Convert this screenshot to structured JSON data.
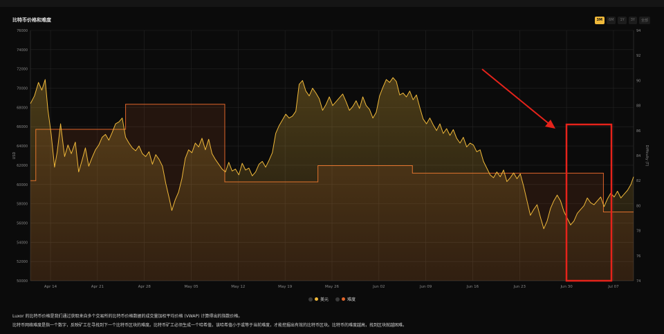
{
  "title": "比特币价格和难度",
  "ranges": [
    "3M",
    "6M",
    "1Y",
    "3Y",
    "全部"
  ],
  "active_range": "3M",
  "descriptions": [
    "Luxor 的比特币价格是我们通过获取来自多个交易所的比特币价格数据的成交量加权平均价格 (VWAP) 计算得出的指数价格。",
    "比特币网络难度是指一个数字，反映矿工在寻找到下一个比特币区块的难度。比特币矿工必须生成一个哈希值，该哈希值小于或等于当前难度，才能挖掘出有效的比特币区块。比特币的难度越高，找到区块就越困难。"
  ],
  "colors": {
    "price": "#f0b93a",
    "difficulty": "#e0652b",
    "annotation": "#e5231b"
  },
  "chart_data": {
    "type": "line",
    "xlabel": "",
    "ylabel": "USD",
    "y2label": "Difficulty (T)",
    "ylim": [
      50000,
      76000
    ],
    "y2lim": [
      74,
      94
    ],
    "y_ticks": [
      50000,
      52000,
      54000,
      56000,
      58000,
      60000,
      62000,
      64000,
      66000,
      68000,
      70000,
      72000,
      74000,
      76000
    ],
    "y2_ticks": [
      74,
      76,
      78,
      80,
      82,
      84,
      86,
      88,
      90,
      92,
      94
    ],
    "x_ticks": [
      "Apr 14",
      "Apr 21",
      "Apr 28",
      "May 05",
      "May 12",
      "May 19",
      "May 26",
      "Jun 02",
      "Jun 09",
      "Jun 16",
      "Jun 23",
      "Jun 30",
      "Jul 07"
    ],
    "x_tick_days": [
      3,
      10,
      17,
      24,
      31,
      38,
      45,
      52,
      59,
      66,
      73,
      80,
      87
    ],
    "x_range_days": [
      0,
      90
    ],
    "series": [
      {
        "name": "美元",
        "kind": "price",
        "points": [
          [
            0,
            68400
          ],
          [
            0.6,
            69200
          ],
          [
            1.2,
            70600
          ],
          [
            1.7,
            69800
          ],
          [
            2.2,
            70900
          ],
          [
            2.6,
            67800
          ],
          [
            3.1,
            65200
          ],
          [
            3.6,
            61800
          ],
          [
            4.0,
            63400
          ],
          [
            4.5,
            66300
          ],
          [
            5.1,
            62900
          ],
          [
            5.6,
            64100
          ],
          [
            6.1,
            63200
          ],
          [
            6.7,
            64400
          ],
          [
            7.2,
            61300
          ],
          [
            7.7,
            62500
          ],
          [
            8.2,
            63800
          ],
          [
            8.7,
            61900
          ],
          [
            9.2,
            62800
          ],
          [
            9.7,
            63600
          ],
          [
            10.2,
            64100
          ],
          [
            10.7,
            64900
          ],
          [
            11.2,
            65200
          ],
          [
            11.7,
            64600
          ],
          [
            12.2,
            65400
          ],
          [
            12.7,
            66300
          ],
          [
            13.2,
            66500
          ],
          [
            13.7,
            66900
          ],
          [
            14.2,
            64900
          ],
          [
            14.7,
            64300
          ],
          [
            15.2,
            63800
          ],
          [
            15.7,
            63500
          ],
          [
            16.2,
            64000
          ],
          [
            16.7,
            63200
          ],
          [
            17.2,
            62900
          ],
          [
            17.7,
            63400
          ],
          [
            18.2,
            62100
          ],
          [
            18.7,
            63100
          ],
          [
            19.2,
            62600
          ],
          [
            19.7,
            61900
          ],
          [
            20.2,
            60100
          ],
          [
            20.7,
            58600
          ],
          [
            21.1,
            57300
          ],
          [
            21.6,
            58400
          ],
          [
            22.1,
            59200
          ],
          [
            22.6,
            60600
          ],
          [
            23.1,
            62700
          ],
          [
            23.6,
            63600
          ],
          [
            24.1,
            63300
          ],
          [
            24.6,
            64300
          ],
          [
            25.1,
            63900
          ],
          [
            25.6,
            64800
          ],
          [
            26.1,
            63600
          ],
          [
            26.6,
            64700
          ],
          [
            27.1,
            63200
          ],
          [
            27.6,
            62600
          ],
          [
            28.1,
            62100
          ],
          [
            28.6,
            61600
          ],
          [
            29.1,
            61300
          ],
          [
            29.6,
            62300
          ],
          [
            30.1,
            61400
          ],
          [
            30.6,
            61600
          ],
          [
            31.1,
            61000
          ],
          [
            31.6,
            62200
          ],
          [
            32.1,
            61500
          ],
          [
            32.6,
            61700
          ],
          [
            33.1,
            60900
          ],
          [
            33.6,
            61300
          ],
          [
            34.1,
            62100
          ],
          [
            34.6,
            62400
          ],
          [
            35.1,
            61800
          ],
          [
            35.6,
            62500
          ],
          [
            36.1,
            63300
          ],
          [
            36.6,
            65300
          ],
          [
            37.1,
            66100
          ],
          [
            37.6,
            66700
          ],
          [
            38.1,
            67300
          ],
          [
            38.6,
            66900
          ],
          [
            39.1,
            67100
          ],
          [
            39.6,
            67600
          ],
          [
            40.1,
            70400
          ],
          [
            40.6,
            70800
          ],
          [
            41.1,
            69700
          ],
          [
            41.6,
            69200
          ],
          [
            42.1,
            70000
          ],
          [
            42.6,
            69500
          ],
          [
            43.1,
            68900
          ],
          [
            43.6,
            67700
          ],
          [
            44.1,
            68300
          ],
          [
            44.6,
            69100
          ],
          [
            45.1,
            68200
          ],
          [
            45.6,
            68600
          ],
          [
            46.1,
            69000
          ],
          [
            46.6,
            69400
          ],
          [
            47.1,
            68600
          ],
          [
            47.6,
            67700
          ],
          [
            48.1,
            68100
          ],
          [
            48.6,
            68700
          ],
          [
            49.1,
            67900
          ],
          [
            49.6,
            69100
          ],
          [
            50.1,
            68200
          ],
          [
            50.6,
            67800
          ],
          [
            51.1,
            66900
          ],
          [
            51.6,
            67500
          ],
          [
            52.1,
            69200
          ],
          [
            52.6,
            70100
          ],
          [
            53.1,
            70900
          ],
          [
            53.6,
            70600
          ],
          [
            54.1,
            71100
          ],
          [
            54.6,
            70700
          ],
          [
            55.1,
            69300
          ],
          [
            55.6,
            69500
          ],
          [
            56.1,
            69100
          ],
          [
            56.6,
            69700
          ],
          [
            57.1,
            68800
          ],
          [
            57.6,
            69300
          ],
          [
            58.1,
            68000
          ],
          [
            58.6,
            66800
          ],
          [
            59.1,
            66300
          ],
          [
            59.6,
            66900
          ],
          [
            60.1,
            66200
          ],
          [
            60.6,
            65600
          ],
          [
            61.1,
            66300
          ],
          [
            61.6,
            65300
          ],
          [
            62.1,
            65800
          ],
          [
            62.6,
            65100
          ],
          [
            63.1,
            65700
          ],
          [
            63.6,
            64800
          ],
          [
            64.1,
            64300
          ],
          [
            64.6,
            64900
          ],
          [
            65.1,
            63900
          ],
          [
            65.6,
            64300
          ],
          [
            66.1,
            64100
          ],
          [
            66.6,
            63400
          ],
          [
            67.1,
            63600
          ],
          [
            67.6,
            62400
          ],
          [
            68.1,
            61700
          ],
          [
            68.6,
            61000
          ],
          [
            69.1,
            60700
          ],
          [
            69.6,
            61300
          ],
          [
            70.1,
            60800
          ],
          [
            70.6,
            61500
          ],
          [
            71.1,
            60300
          ],
          [
            71.6,
            60700
          ],
          [
            72.1,
            61200
          ],
          [
            72.6,
            60600
          ],
          [
            73.1,
            61100
          ],
          [
            73.6,
            59800
          ],
          [
            74.1,
            58300
          ],
          [
            74.6,
            56800
          ],
          [
            75.1,
            57400
          ],
          [
            75.6,
            57900
          ],
          [
            76.1,
            56600
          ],
          [
            76.6,
            55400
          ],
          [
            77.1,
            56200
          ],
          [
            77.6,
            57500
          ],
          [
            78.1,
            58300
          ],
          [
            78.6,
            58900
          ],
          [
            79.1,
            58300
          ],
          [
            79.6,
            57200
          ],
          [
            80.1,
            56500
          ],
          [
            80.6,
            55800
          ],
          [
            81.1,
            56200
          ],
          [
            81.6,
            57000
          ],
          [
            82.1,
            57400
          ],
          [
            82.6,
            57800
          ],
          [
            83.1,
            58600
          ],
          [
            83.6,
            58100
          ],
          [
            84.1,
            57900
          ],
          [
            84.6,
            58300
          ],
          [
            85.1,
            58700
          ],
          [
            85.6,
            57700
          ],
          [
            86.1,
            58500
          ],
          [
            86.6,
            59100
          ],
          [
            87.1,
            58700
          ],
          [
            87.6,
            59300
          ],
          [
            88.1,
            58600
          ],
          [
            88.6,
            59000
          ],
          [
            89.1,
            59400
          ],
          [
            89.6,
            60000
          ],
          [
            90,
            60800
          ]
        ]
      },
      {
        "name": "难度",
        "kind": "difficulty",
        "points": [
          [
            0,
            82.0
          ],
          [
            0.8,
            82.0
          ],
          [
            0.8,
            86.1
          ],
          [
            14.2,
            86.1
          ],
          [
            14.2,
            88.1
          ],
          [
            29.0,
            88.1
          ],
          [
            29.0,
            81.9
          ],
          [
            42.9,
            81.9
          ],
          [
            42.9,
            83.2
          ],
          [
            57.0,
            83.2
          ],
          [
            57.0,
            82.6
          ],
          [
            85.5,
            82.6
          ],
          [
            85.5,
            79.5
          ],
          [
            90,
            79.5
          ]
        ]
      }
    ],
    "legend": [
      {
        "label": "美元",
        "color": "#f0b93a"
      },
      {
        "label": "难度",
        "color": "#e0652b"
      }
    ],
    "legend_placement": "bottom-center",
    "grid": true
  }
}
